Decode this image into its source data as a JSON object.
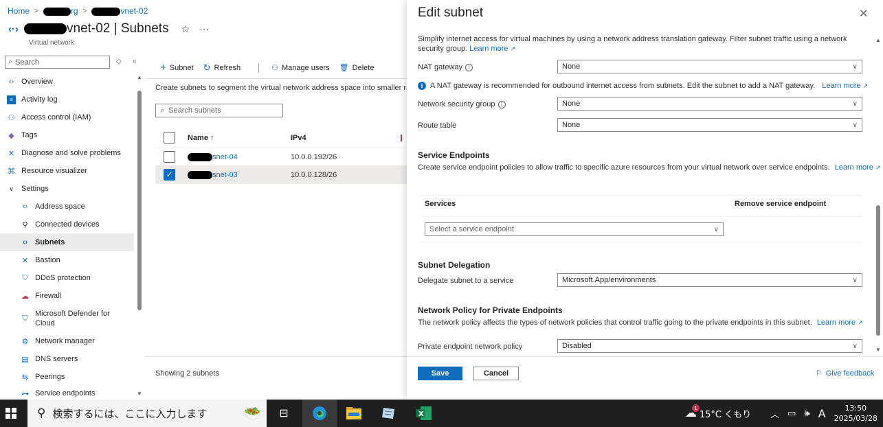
{
  "breadcrumb": {
    "home": "Home",
    "rg_suffix": "rg",
    "vnet_suffix": "vnet-02"
  },
  "resource": {
    "title_suffix": "vnet-02 | Subnets",
    "subtitle": "Virtual network"
  },
  "sidebar": {
    "search_placeholder": "Search",
    "items": [
      {
        "label": "Overview"
      },
      {
        "label": "Activity log"
      },
      {
        "label": "Access control (IAM)"
      },
      {
        "label": "Tags"
      },
      {
        "label": "Diagnose and solve problems"
      },
      {
        "label": "Resource visualizer"
      },
      {
        "label": "Settings"
      },
      {
        "label": "Address space"
      },
      {
        "label": "Connected devices"
      },
      {
        "label": "Subnets"
      },
      {
        "label": "Bastion"
      },
      {
        "label": "DDoS protection"
      },
      {
        "label": "Firewall"
      },
      {
        "label": "Microsoft Defender for Cloud"
      },
      {
        "label": "Network manager"
      },
      {
        "label": "DNS servers"
      },
      {
        "label": "Peerings"
      },
      {
        "label": "Service endpoints"
      }
    ]
  },
  "toolbar": {
    "subnet": "Subnet",
    "refresh": "Refresh",
    "manage_users": "Manage users",
    "delete": "Delete"
  },
  "main": {
    "description": "Create subnets to segment the virtual network address space into smaller ranges",
    "search_placeholder": "Search subnets",
    "columns": {
      "name": "Name ↑",
      "ipv4": "IPv4"
    },
    "rows": [
      {
        "name_suffix": "snet-04",
        "ipv4": "10.0.0.192/26",
        "checked": false
      },
      {
        "name_suffix": "snet-03",
        "ipv4": "10.0.0.128/26",
        "checked": true
      }
    ],
    "showing": "Showing 2 subnets"
  },
  "panel": {
    "title": "Edit subnet",
    "intro": "Simplify internet access for virtual machines by using a network address translation gateway. Filter subnet traffic using a network security group.",
    "learn_more": "Learn more",
    "nat_label": "NAT gateway",
    "nat_value": "None",
    "nat_info": "A NAT gateway is recommended for outbound internet access from subnets. Edit the subnet to add a NAT gateway.",
    "nsg_label": "Network security group",
    "nsg_value": "None",
    "route_label": "Route table",
    "route_value": "None",
    "se_title": "Service Endpoints",
    "se_desc": "Create service endpoint policies to allow traffic to specific azure resources from your virtual network over service endpoints.",
    "se_col_services": "Services",
    "se_col_remove": "Remove service endpoint",
    "se_placeholder": "Select a service endpoint",
    "del_title": "Subnet Delegation",
    "del_label": "Delegate subnet to a service",
    "del_value": "Microsoft.App/environments",
    "npe_title": "Network Policy for Private Endpoints",
    "npe_desc": "The network policy affects the types of network policies that control traffic going to the private endpoints in this subnet.",
    "pe_label": "Private endpoint network policy",
    "pe_value": "Disabled",
    "save": "Save",
    "cancel": "Cancel",
    "feedback": "Give feedback"
  },
  "taskbar": {
    "search_placeholder": "検索するには、ここに入力します",
    "weather": "15°C くもり",
    "weather_badge": "1",
    "ime": "A",
    "time": "13:50",
    "date": "2025/03/28"
  },
  "colors": {
    "accent": "#0f6cbd",
    "taskbar": "#1f1f1f"
  }
}
